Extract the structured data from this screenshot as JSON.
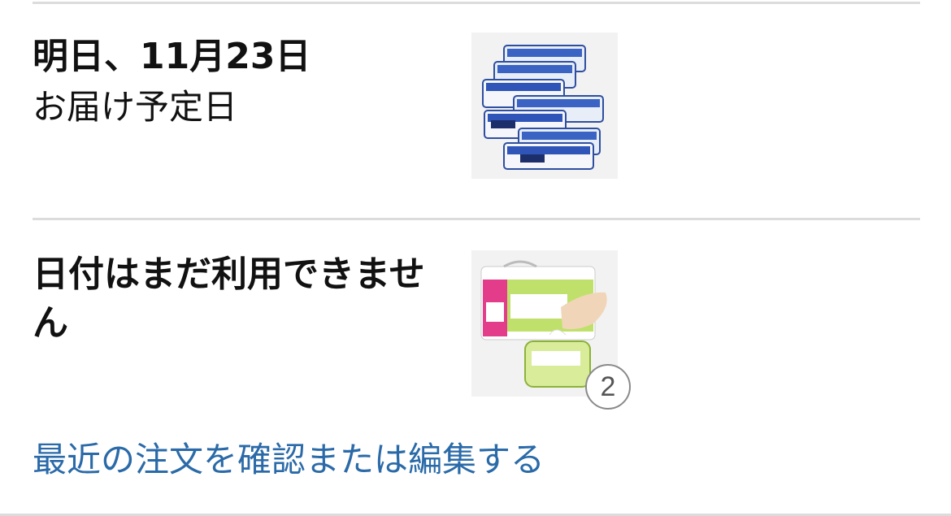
{
  "deliveries": [
    {
      "date_title": "明日、11月23日",
      "date_subtitle": "お届け予定日",
      "product_image": "wet-sheets-multipack-image"
    },
    {
      "date_title": "日付はまだ利用できません",
      "product_image": "wet-tissue-8pack-image",
      "quantity_badge": "2"
    }
  ],
  "edit_link": "最近の注文を確認または編集する",
  "colors": {
    "link": "#2a6aa8",
    "divider": "#dcdcdc",
    "thumb_bg": "#f2f2f2"
  }
}
